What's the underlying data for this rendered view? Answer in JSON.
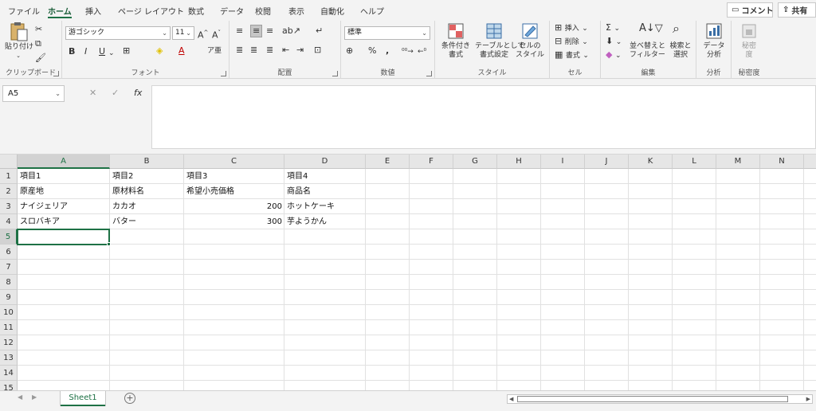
{
  "ribbon_tabs": [
    "ファイル",
    "ホーム",
    "挿入",
    "ページ レイアウト",
    "数式",
    "データ",
    "校閲",
    "表示",
    "自動化",
    "ヘルプ"
  ],
  "active_tab_index": 1,
  "top_buttons": {
    "comment": "コメント",
    "share": "共有"
  },
  "clipboard": {
    "paste": "貼り付け",
    "label": "クリップボード"
  },
  "font": {
    "name": "游ゴシック",
    "size": "11",
    "bold": "B",
    "italic": "I",
    "underline": "U",
    "label": "フォント"
  },
  "alignment": {
    "label": "配置"
  },
  "number": {
    "format": "標準",
    "percent": "%",
    "comma": ",",
    "label": "数値"
  },
  "styles": {
    "conditional_1": "条件付き",
    "conditional_2": "書式",
    "table_1": "テーブルとして",
    "table_2": "書式設定",
    "cell_1": "セルの",
    "cell_2": "スタイル",
    "label": "スタイル"
  },
  "cells": {
    "insert": "挿入",
    "delete": "削除",
    "format": "書式",
    "label": "セル"
  },
  "editing": {
    "sum": "Σ",
    "sort_1": "並べ替えと",
    "sort_2": "フィルター",
    "find_1": "検索と",
    "find_2": "選択",
    "label": "編集"
  },
  "analysis": {
    "btn_1": "データ",
    "btn_2": "分析",
    "label": "分析"
  },
  "sensitivity": {
    "btn_1": "秘密",
    "btn_2": "度",
    "label": "秘密度"
  },
  "formula_bar": {
    "name_box": "A5",
    "fx": "fx",
    "formula": ""
  },
  "columns": [
    "A",
    "B",
    "C",
    "D",
    "E",
    "F",
    "G",
    "H",
    "I",
    "J",
    "K",
    "L",
    "M",
    "N"
  ],
  "rows": [
    "1",
    "2",
    "3",
    "4",
    "5",
    "6",
    "7",
    "8",
    "9",
    "10",
    "11",
    "12",
    "13",
    "14",
    "15"
  ],
  "selected_column": "A",
  "selected_row": "5",
  "sheet_rows": [
    [
      "項目1",
      "項目2",
      "項目3",
      "項目4"
    ],
    [
      "原産地",
      "原材料名",
      "希望小売価格",
      "商品名"
    ],
    [
      "ナイジェリア",
      "カカオ",
      "200",
      "ホットケーキ"
    ],
    [
      "スロバキア",
      "バター",
      "300",
      "芋ようかん"
    ]
  ],
  "sheet_tabs": [
    "Sheet1"
  ],
  "add_sheet": "+",
  "colors": {
    "accent": "#1e7145",
    "ribbon_bg": "#f3f3f3",
    "header_bg": "#e6e6e6",
    "gridline": "#e1e1e1"
  }
}
